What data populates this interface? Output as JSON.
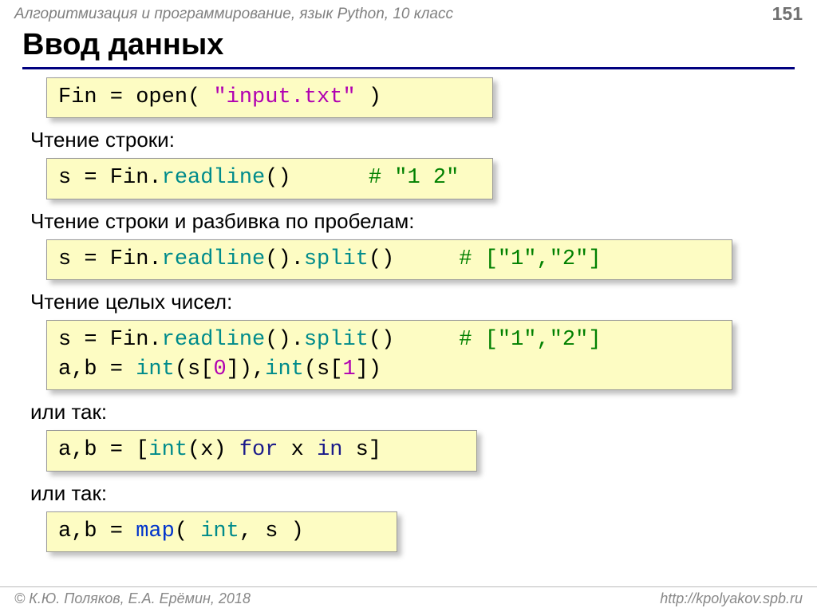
{
  "header": {
    "course": "Алгоритмизация и программирование, язык Python, 10 класс",
    "page_number": "151"
  },
  "title": "Ввод данных",
  "code_open": {
    "prefix": "Fin = open( ",
    "string": "\"input.txt\"",
    "suffix": " )"
  },
  "label_readline": "Чтение строки:",
  "code_readline": {
    "lhs": "s",
    "eq_rhs": " = Fin.",
    "method": "readline",
    "after": "()      ",
    "comment": "# \"1 2\""
  },
  "label_split": "Чтение строки и разбивка по пробелам:",
  "code_split": {
    "lhs": "s",
    "mid": " = Fin.",
    "m1": "readline",
    "sep": "().",
    "m2": "split",
    "after": "()     ",
    "comment": "# [\"1\",\"2\"]"
  },
  "label_ints": "Чтение целых чисел:",
  "code_ints": {
    "l1_lhs": "s",
    "l1_mid": " = Fin.",
    "l1_m1": "readline",
    "l1_sep": "().",
    "l1_m2": "split",
    "l1_after": "()     ",
    "l1_comment": "# [\"1\",\"2\"]",
    "l2_a": "a,b = ",
    "l2_int1": "int",
    "l2_mid1": "(s[",
    "l2_zero": "0",
    "l2_mid2": "]),",
    "l2_int2": "int",
    "l2_mid3": "(s[",
    "l2_one": "1",
    "l2_mid4": "])"
  },
  "label_or1": "или так:",
  "code_listcomp": {
    "a": "a,b = [",
    "int": "int",
    "b": "(x) ",
    "for": "for",
    "c": " x ",
    "in": "in",
    "d": " s]"
  },
  "label_or2": "или так:",
  "code_map": {
    "a": "a,b = ",
    "map": "map",
    "b": "( ",
    "int": "int",
    "c": ", s )"
  },
  "footer": {
    "left": "© К.Ю. Поляков, Е.А. Ерёмин, 2018",
    "right": "http://kpolyakov.spb.ru"
  }
}
